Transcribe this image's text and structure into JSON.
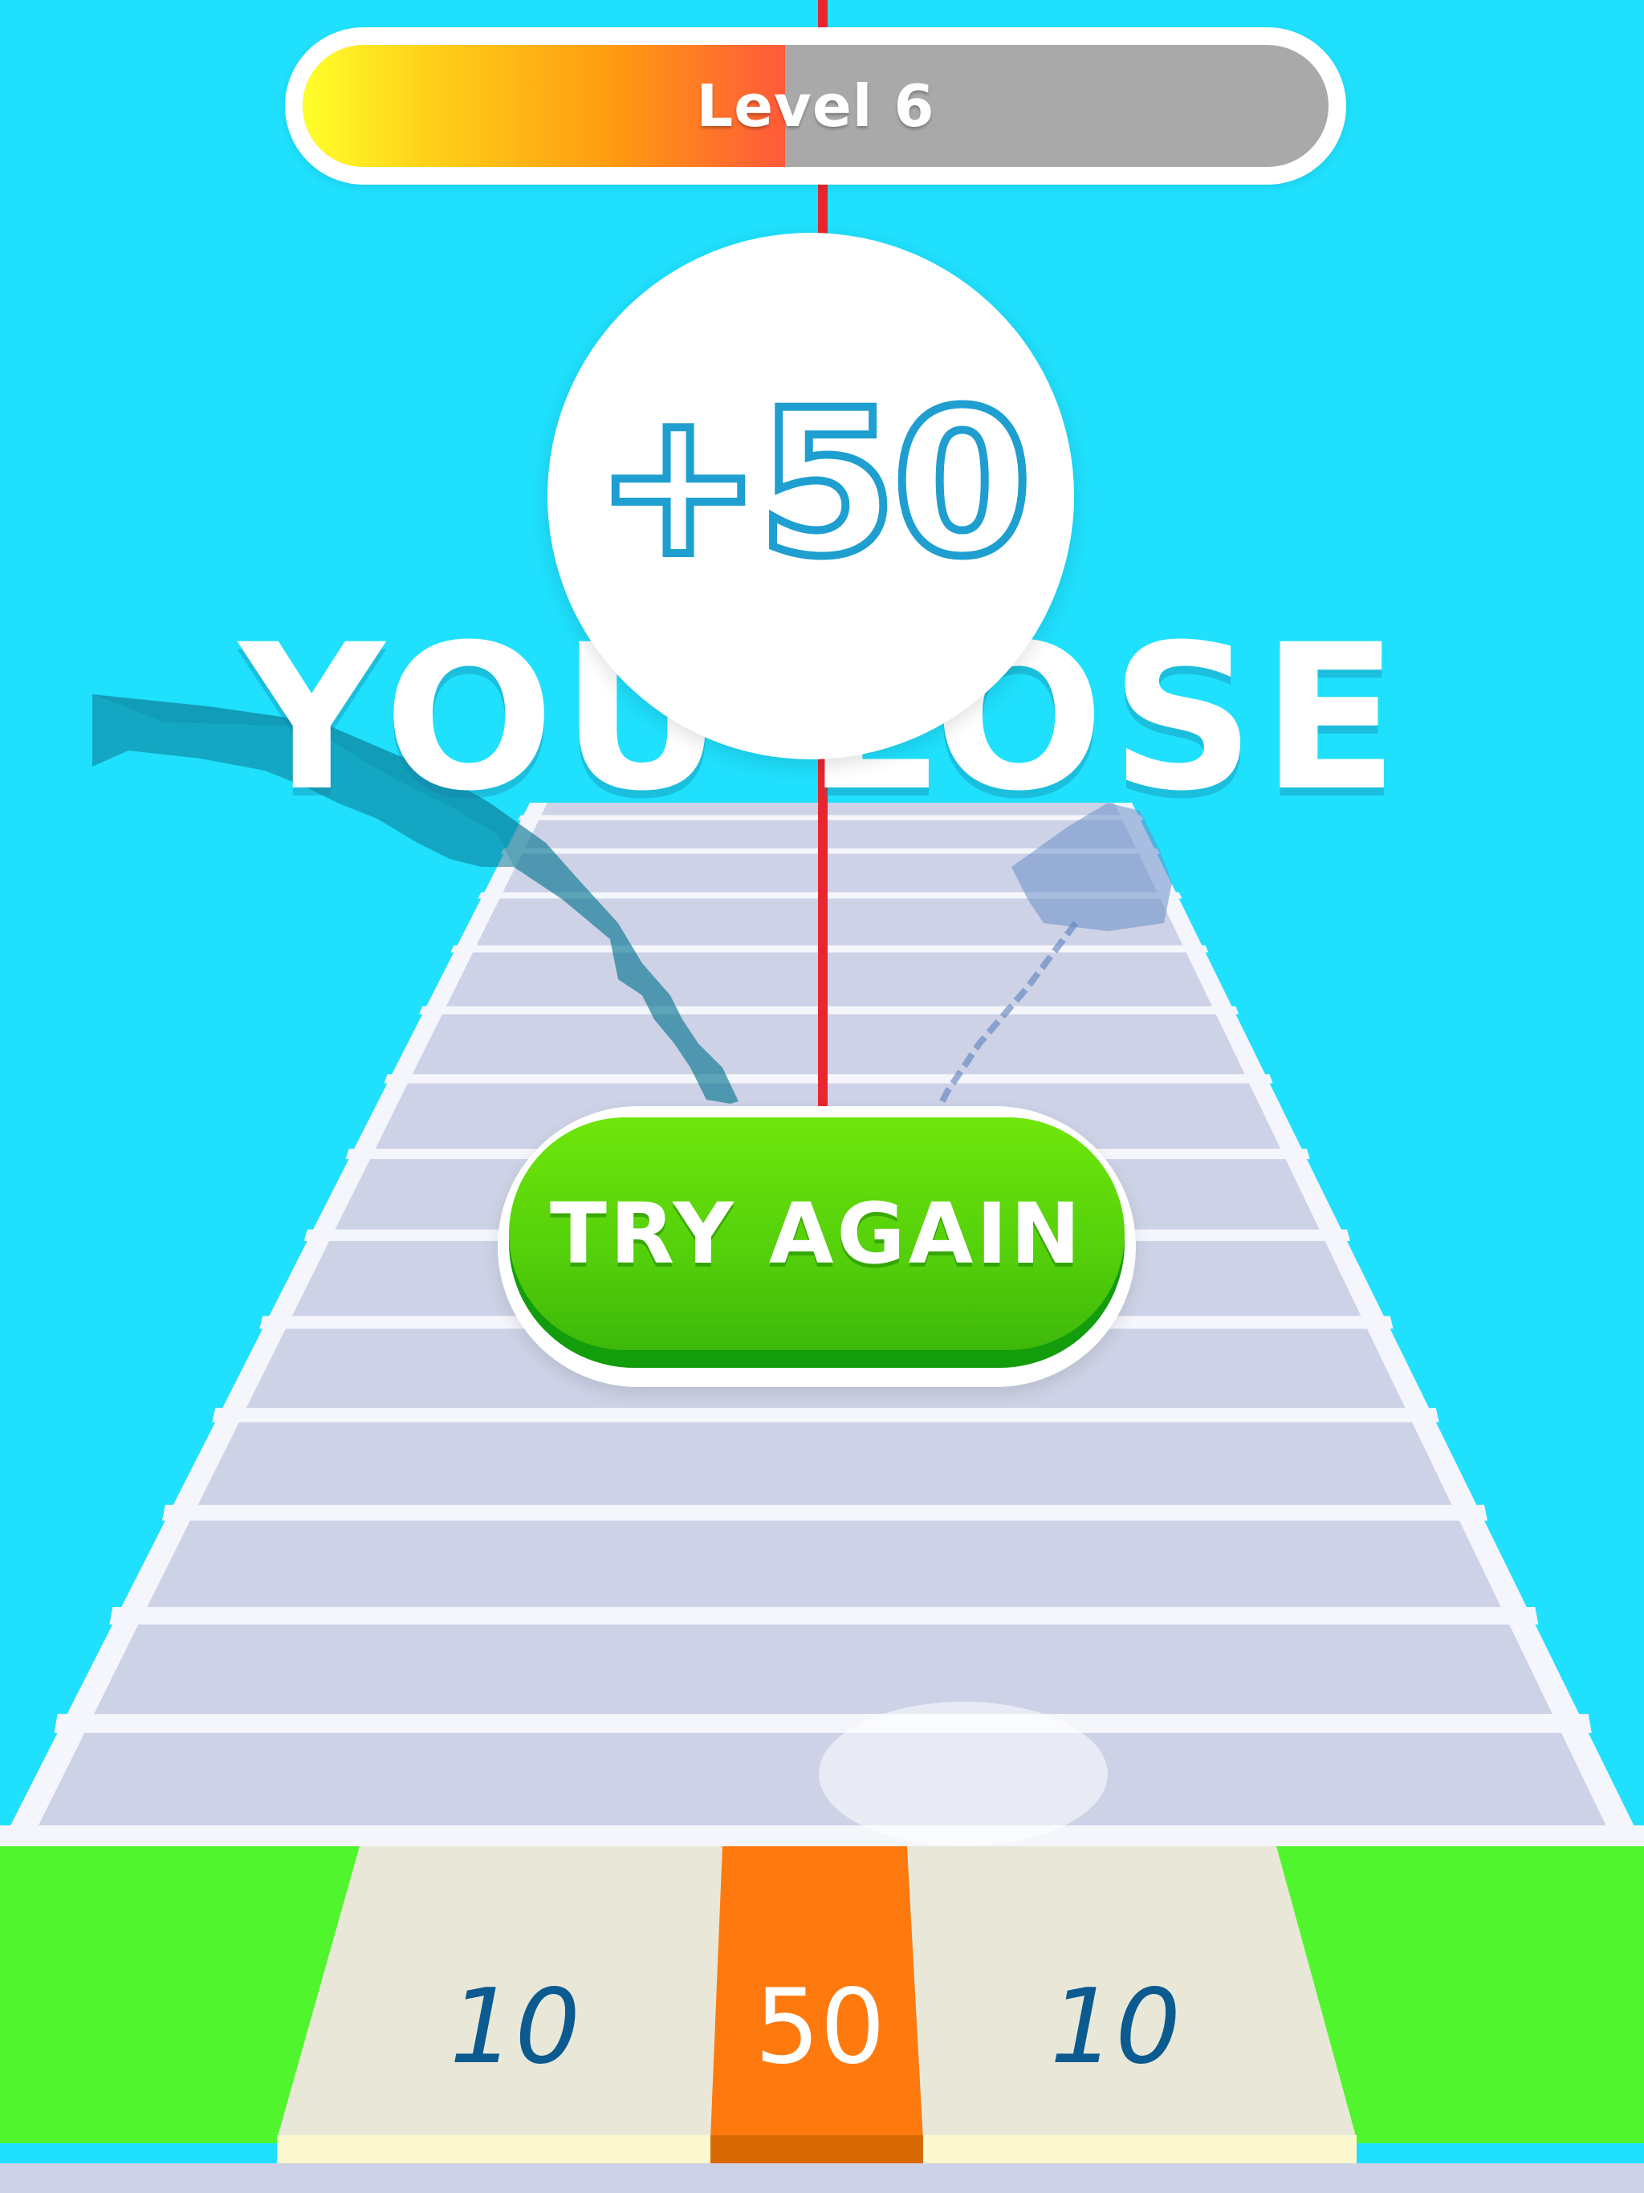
{
  "hud": {
    "level_label": "Level 6",
    "progress": 0.47
  },
  "result": {
    "title": "YOU LOSE",
    "score_gain": "+50"
  },
  "actions": {
    "try_again_label": "TRY AGAIN"
  },
  "bottom_tiles": {
    "left": "10",
    "middle": "50",
    "right": "10"
  },
  "colors": {
    "sky": "#1fe0fd",
    "grass": "#51f52d",
    "stair": "#cdd2e6",
    "stair_edge": "#f4f6fc",
    "rope": "#e8262f",
    "orange_tile": "#ff7a0e",
    "cream_tile": "#e9e8d8",
    "button_green": "#5bd80b"
  }
}
